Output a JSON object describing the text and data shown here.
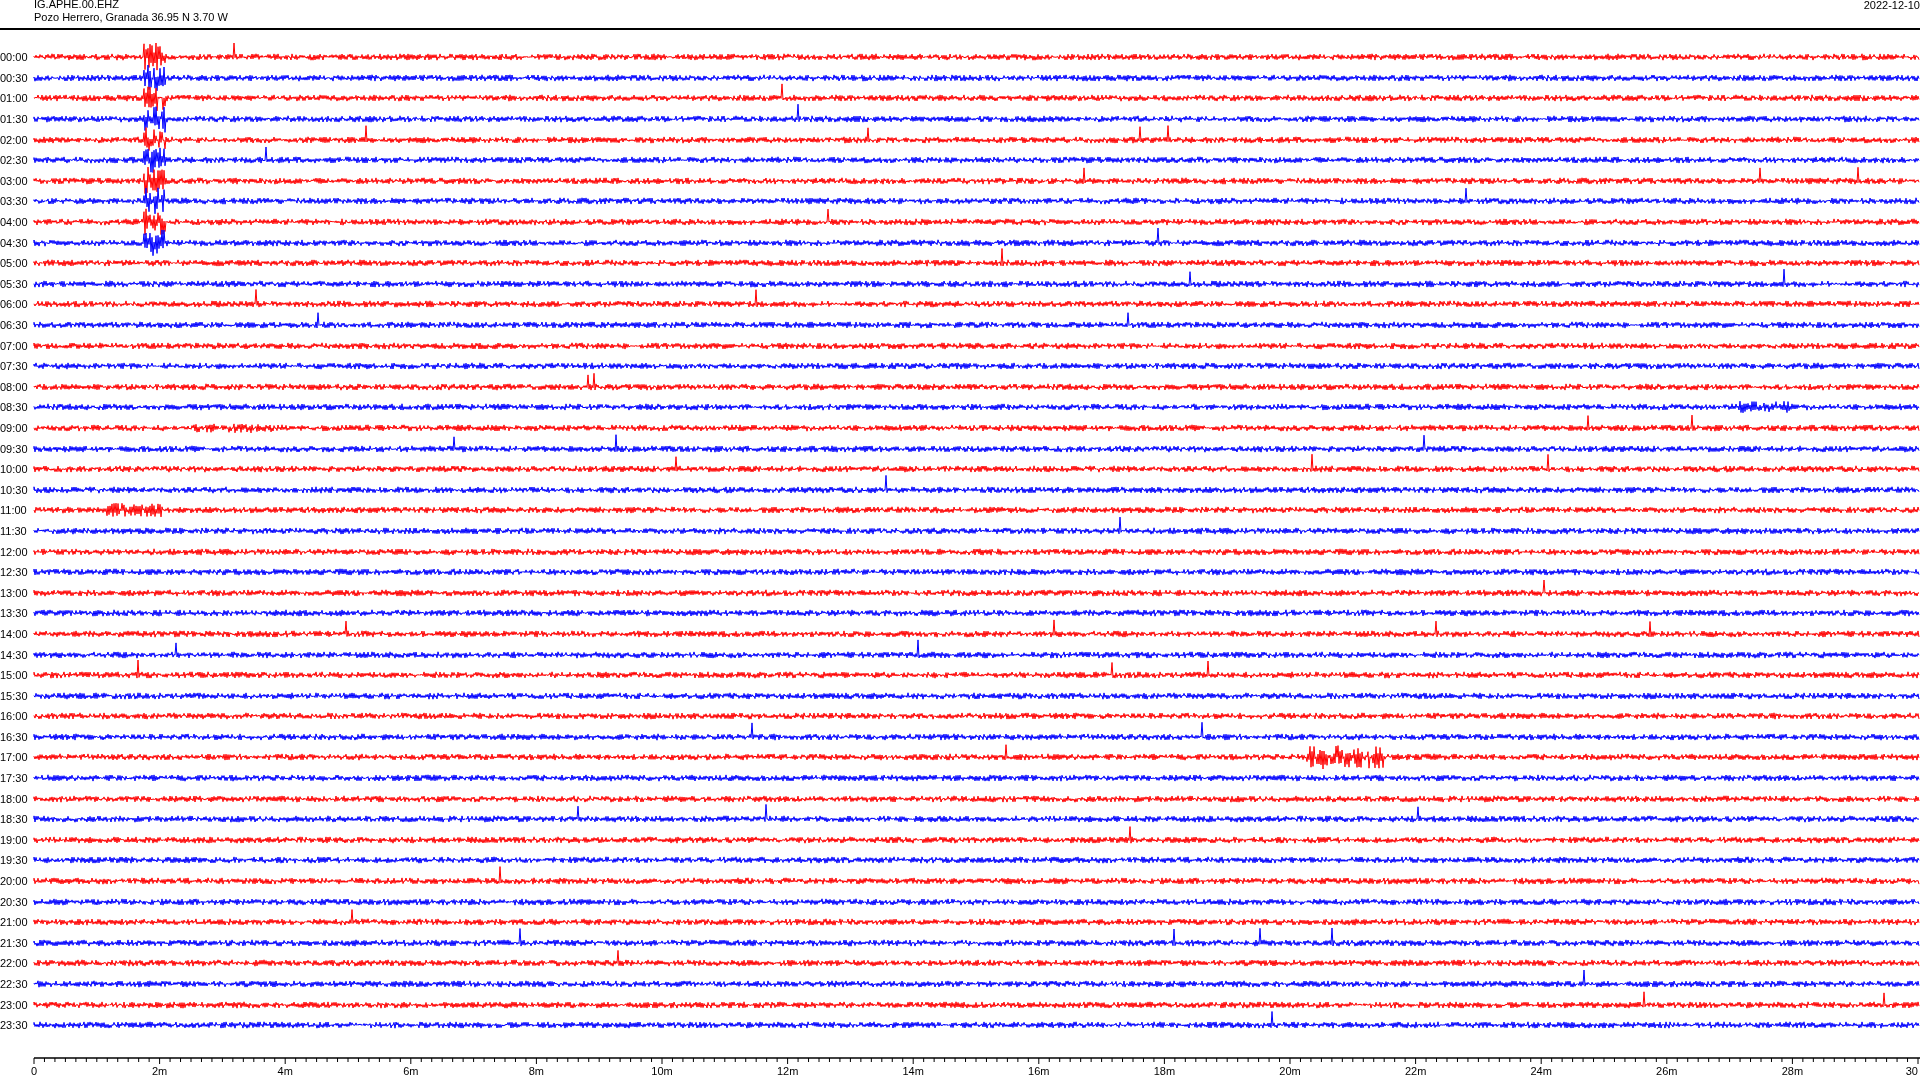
{
  "header": {
    "station": "IG.APHE.00.EHZ",
    "location": "Pozo Herrero, Granada  36.95 N 3.70 W",
    "date": "2022-12-10"
  },
  "rows": [
    {
      "time": "00:00",
      "color": "#ff0000"
    },
    {
      "time": "00:30",
      "color": "#0000ff"
    },
    {
      "time": "01:00",
      "color": "#ff0000"
    },
    {
      "time": "01:30",
      "color": "#0000ff"
    },
    {
      "time": "02:00",
      "color": "#ff0000"
    },
    {
      "time": "02:30",
      "color": "#0000ff"
    },
    {
      "time": "03:00",
      "color": "#ff0000"
    },
    {
      "time": "03:30",
      "color": "#0000ff"
    },
    {
      "time": "04:00",
      "color": "#ff0000"
    },
    {
      "time": "04:30",
      "color": "#0000ff"
    },
    {
      "time": "05:00",
      "color": "#ff0000"
    },
    {
      "time": "05:30",
      "color": "#0000ff"
    },
    {
      "time": "06:00",
      "color": "#ff0000"
    },
    {
      "time": "06:30",
      "color": "#0000ff"
    },
    {
      "time": "07:00",
      "color": "#ff0000"
    },
    {
      "time": "07:30",
      "color": "#0000ff"
    },
    {
      "time": "08:00",
      "color": "#ff0000"
    },
    {
      "time": "08:30",
      "color": "#0000ff"
    },
    {
      "time": "09:00",
      "color": "#ff0000"
    },
    {
      "time": "09:30",
      "color": "#0000ff"
    },
    {
      "time": "10:00",
      "color": "#ff0000"
    },
    {
      "time": "10:30",
      "color": "#0000ff"
    },
    {
      "time": "11:00",
      "color": "#ff0000"
    },
    {
      "time": "11:30",
      "color": "#0000ff"
    },
    {
      "time": "12:00",
      "color": "#ff0000"
    },
    {
      "time": "12:30",
      "color": "#0000ff"
    },
    {
      "time": "13:00",
      "color": "#ff0000"
    },
    {
      "time": "13:30",
      "color": "#0000ff"
    },
    {
      "time": "14:00",
      "color": "#ff0000"
    },
    {
      "time": "14:30",
      "color": "#0000ff"
    },
    {
      "time": "15:00",
      "color": "#ff0000"
    },
    {
      "time": "15:30",
      "color": "#0000ff"
    },
    {
      "time": "16:00",
      "color": "#ff0000"
    },
    {
      "time": "16:30",
      "color": "#0000ff"
    },
    {
      "time": "17:00",
      "color": "#ff0000"
    },
    {
      "time": "17:30",
      "color": "#0000ff"
    },
    {
      "time": "18:00",
      "color": "#ff0000"
    },
    {
      "time": "18:30",
      "color": "#0000ff"
    },
    {
      "time": "19:00",
      "color": "#ff0000"
    },
    {
      "time": "19:30",
      "color": "#0000ff"
    },
    {
      "time": "20:00",
      "color": "#ff0000"
    },
    {
      "time": "20:30",
      "color": "#0000ff"
    },
    {
      "time": "21:00",
      "color": "#ff0000"
    },
    {
      "time": "21:30",
      "color": "#0000ff"
    },
    {
      "time": "22:00",
      "color": "#ff0000"
    },
    {
      "time": "22:30",
      "color": "#0000ff"
    },
    {
      "time": "23:00",
      "color": "#ff0000"
    },
    {
      "time": "23:30",
      "color": "#0000ff"
    }
  ],
  "time_axis": [
    "0",
    "2m",
    "4m",
    "6m",
    "8m",
    "10m",
    "12m",
    "14m",
    "16m",
    "18m",
    "20m",
    "22m",
    "24m",
    "26m",
    "28m",
    "30"
  ]
}
